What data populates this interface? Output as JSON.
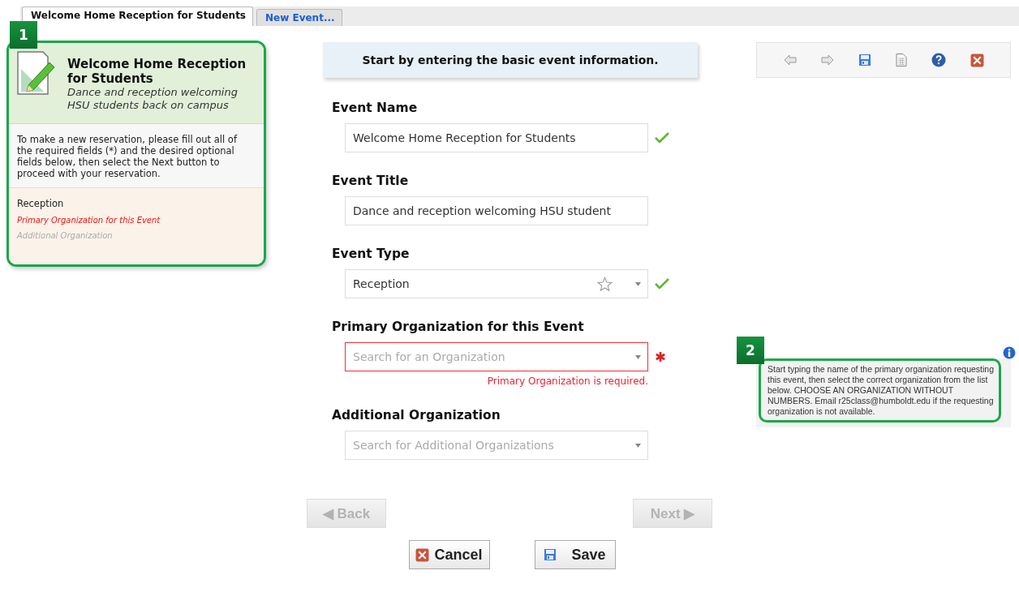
{
  "tabs": [
    {
      "label": "Welcome Home Reception for Students",
      "selected": true
    },
    {
      "label": "New Event...",
      "selected": false
    }
  ],
  "summary": {
    "badge": "1",
    "title": "Welcome Home Reception for Students",
    "subtitle": "Dance and reception welcoming HSU students back on campus",
    "instructions": "To make a new reservation, please fill out all of the required fields (*) and the desired optional fields below, then select the Next button to proceed with your reservation.",
    "checklist": [
      {
        "label": "Reception",
        "kind": "done"
      },
      {
        "label": "Primary Organization for this Event",
        "kind": "required"
      },
      {
        "label": "Additional Organization",
        "kind": "optional"
      }
    ]
  },
  "header": "Start by entering the basic event information.",
  "fields": [
    {
      "label": "Event Name",
      "kind": "text",
      "value": "Welcome Home Reception for Students",
      "valid": true,
      "required": false
    },
    {
      "label": "Event Title",
      "kind": "text",
      "value": "Dance and reception welcoming HSU student",
      "valid": false,
      "required": false
    },
    {
      "label": "Event Type",
      "kind": "select",
      "value": "Reception",
      "valid": true,
      "required": false
    },
    {
      "label": "Primary Organization for this Event",
      "kind": "search",
      "placeholder": "Search for an Organization",
      "valid": false,
      "required": true,
      "error": "Primary Organization is required."
    },
    {
      "label": "Additional Organization",
      "kind": "search",
      "placeholder": "Search for Additional Organizations",
      "valid": false,
      "required": false
    }
  ],
  "help": {
    "badge": "2",
    "text": "Start typing the name of the primary organization requesting this event, then select the correct organization from the list below. CHOOSE AN ORGANIZATION WITHOUT NUMBERS. Email r25class@humboldt.edu if the requesting organization is not available."
  },
  "nav": [
    {
      "label": "◀ Back",
      "disabled": true
    },
    {
      "label": "Next ▶",
      "disabled": true
    }
  ],
  "actions": [
    {
      "label": "Cancel",
      "kind": "cancel"
    },
    {
      "label": "Save",
      "kind": "save"
    }
  ]
}
